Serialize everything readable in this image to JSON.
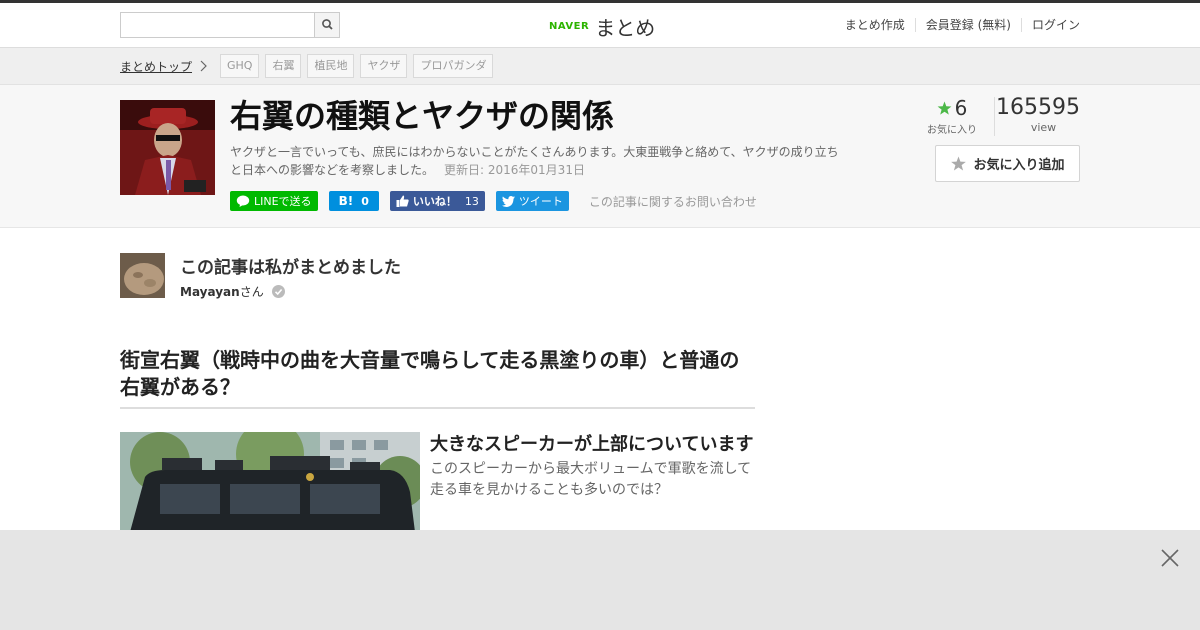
{
  "header": {
    "search": {
      "placeholder": "",
      "value": ""
    },
    "logo": {
      "naver": "NAVER",
      "matome": "まとめ"
    },
    "nav": [
      {
        "label": "まとめ作成"
      },
      {
        "label": "会員登録 (無料)"
      },
      {
        "label": "ログイン"
      }
    ]
  },
  "breadcrumb": {
    "top": "まとめトップ",
    "tags": [
      "GHQ",
      "右翼",
      "植民地",
      "ヤクザ",
      "プロパガンダ"
    ]
  },
  "article": {
    "title": "右翼の種類とヤクザの関係",
    "description": "ヤクザと一言でいっても、庶民にはわからないことがたくさんあります。大東亜戦争と絡めて、ヤクザの成り立ちと日本への影響などを考察しました。",
    "updated": "更新日: 2016年01月31日",
    "share": {
      "line": "LINEで送る",
      "hatena_count": "0",
      "facebook_label": "いいね！",
      "facebook_count": "13",
      "tweet": "ツイート",
      "contact": "この記事に関するお問い合わせ"
    },
    "stats": {
      "favorites": "6",
      "favorites_label": "お気に入り",
      "views": "165595",
      "views_label": "view"
    },
    "favorite_button": "お気に入り追加"
  },
  "author": {
    "heading": "この記事は私がまとめました",
    "name": "Mayayan",
    "suffix": "さん"
  },
  "section": {
    "heading": "街宣右翼（戦時中の曲を大音量で鳴らして走る黒塗りの車）と普通の右翼がある？"
  },
  "item": {
    "title": "大きなスピーカーが上部についています",
    "description": "このスピーカーから最大ボリュームで軍歌を流して走る車を見かけることも多いのでは？"
  },
  "colors": {
    "brand_green": "#2db400",
    "line_green": "#00b900",
    "hatena_blue": "#008fde",
    "facebook_blue": "#3b5998",
    "twitter_blue": "#1b95e0",
    "star_green": "#4cb848"
  },
  "icons": [
    "search-icon",
    "chevron-right-icon",
    "line-icon",
    "hatena-icon",
    "facebook-like-icon",
    "twitter-icon",
    "star-icon",
    "verified-check-icon",
    "close-icon"
  ]
}
